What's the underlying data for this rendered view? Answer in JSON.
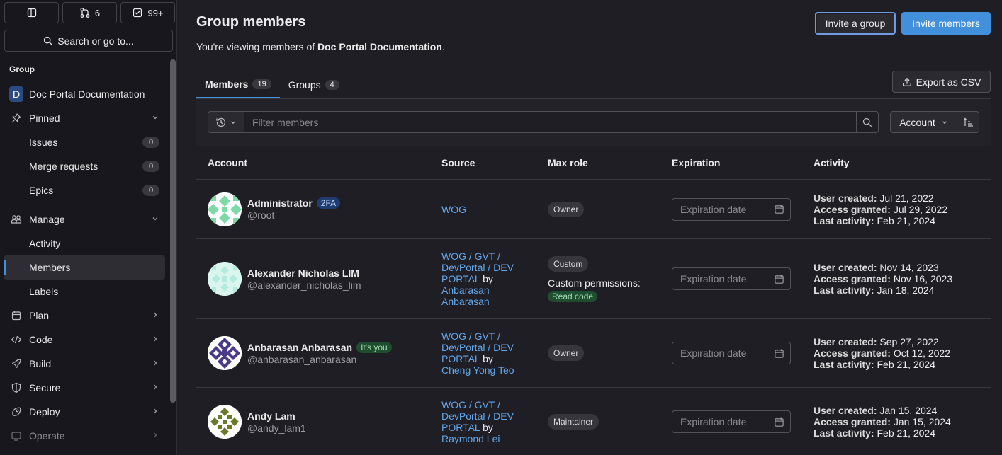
{
  "sidebar": {
    "top_buttons": {
      "mr_count": "6",
      "todo_count": "99+"
    },
    "search_label": "Search or go to...",
    "section_title": "Group",
    "group": {
      "initial": "D",
      "name": "Doc Portal Documentation"
    },
    "pinned": {
      "label": "Pinned",
      "items": [
        {
          "label": "Issues",
          "count": "0"
        },
        {
          "label": "Merge requests",
          "count": "0"
        },
        {
          "label": "Epics",
          "count": "0"
        }
      ]
    },
    "manage": {
      "label": "Manage",
      "items": [
        {
          "label": "Activity"
        },
        {
          "label": "Members"
        },
        {
          "label": "Labels"
        }
      ]
    },
    "sections": [
      {
        "label": "Plan",
        "icon": "plan-icon"
      },
      {
        "label": "Code",
        "icon": "code-icon"
      },
      {
        "label": "Build",
        "icon": "rocket-icon"
      },
      {
        "label": "Secure",
        "icon": "shield-icon"
      },
      {
        "label": "Deploy",
        "icon": "deploy-icon"
      },
      {
        "label": "Operate",
        "icon": "operate-icon"
      }
    ]
  },
  "header": {
    "title": "Group members",
    "subtitle_prefix": "You're viewing members of ",
    "subtitle_group": "Doc Portal Documentation",
    "subtitle_suffix": ".",
    "invite_group": "Invite a group",
    "invite_members": "Invite members"
  },
  "tabs": [
    {
      "label": "Members",
      "count": "19"
    },
    {
      "label": "Groups",
      "count": "4"
    }
  ],
  "export_label": "Export as CSV",
  "filter": {
    "placeholder": "Filter members",
    "sort_label": "Account"
  },
  "table": {
    "headers": {
      "account": "Account",
      "source": "Source",
      "role": "Max role",
      "expiration": "Expiration",
      "activity": "Activity"
    },
    "expiration_placeholder": "Expiration date",
    "activity_labels": {
      "created": "User created:",
      "granted": "Access granted:",
      "last": "Last activity:"
    },
    "rows": [
      {
        "name": "Administrator",
        "badge": "2FA",
        "username": "@root",
        "source_link": "WOG",
        "role": "Owner",
        "created": "Jul 21, 2022",
        "granted": "Jul 29, 2022",
        "last": "Feb 21, 2024"
      },
      {
        "name": "Alexander Nicholas LIM",
        "username": "@alexander_nicholas_lim",
        "source_l1": "WOG / GVT /",
        "source_l2": "DevPortal / DEV",
        "source_l3": "PORTAL",
        "source_by": " by",
        "source_p1": "Anbarasan",
        "source_p2": "Anbarasan",
        "role": "Custom",
        "custom_label": "Custom permissions:",
        "perm": "Read code",
        "created": "Nov 14, 2023",
        "granted": "Nov 16, 2023",
        "last": "Jan 18, 2024"
      },
      {
        "name": "Anbarasan Anbarasan",
        "badge": "It's you",
        "username": "@anbarasan_anbarasan",
        "source_l1": "WOG / GVT /",
        "source_l2": "DevPortal / DEV",
        "source_l3": "PORTAL",
        "source_by": " by",
        "source_p1": "Cheng Yong Teo",
        "role": "Owner",
        "created": "Sep 27, 2022",
        "granted": "Oct 12, 2022",
        "last": "Feb 21, 2024"
      },
      {
        "name": "Andy Lam",
        "username": "@andy_lam1",
        "source_l1": "WOG / GVT /",
        "source_l2": "DevPortal / DEV",
        "source_l3": "PORTAL",
        "source_by": " by",
        "source_p1": "Raymond Lei",
        "role": "Maintainer",
        "created": "Jan 15, 2024",
        "granted": "Jan 15, 2024",
        "last": "Feb 21, 2024"
      }
    ]
  },
  "colors": {
    "accent": "#428fdc",
    "link": "#63a6e9",
    "background": "#1f1e24",
    "sidebar": "#18171d"
  }
}
